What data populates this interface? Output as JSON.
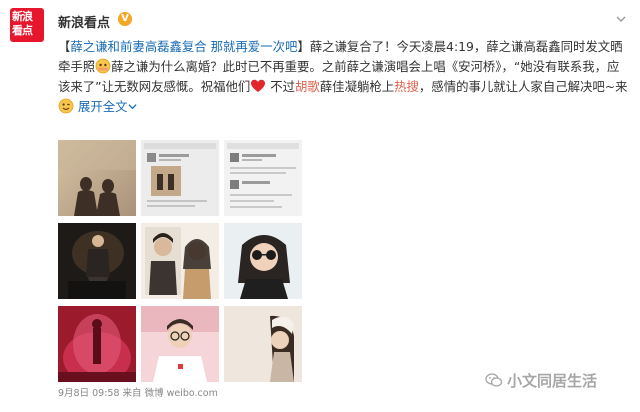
{
  "account": {
    "avatar_line1": "新浪",
    "avatar_line2": "看点",
    "name": "新浪看点",
    "verified_icon": "verified-v-badge"
  },
  "post": {
    "p1": "【",
    "title": "薛之谦和前妻高磊鑫复合 那就再爱一次吧",
    "p2": "】薛之谦复合了！今天凌晨4:19，薛之谦高磊鑫同时发文晒牵手照",
    "p3": "薛之谦为什么离婚？此时已不再重要。之前薛之谦演唱会上唱《安河桥》，“她没有联系我，应该来了”让无数网友感慨。祝福他们",
    "p4": " 不过",
    "highlight1": "胡歌",
    "p5": "薛佳凝躺枪上",
    "highlight2": "热搜",
    "p6": "，感情的事儿就让人家自己解决吧~来",
    "expand_label": "展开全文",
    "link_color": "#1a6bb5",
    "highlight_color": "#e0604d"
  },
  "images": [
    "shadow-silhouette-photo",
    "chat-screenshot-photo",
    "chat-screenshot-photo",
    "stage-performer-photo",
    "magazine-portrait-photo",
    "sunglasses-portrait-photo",
    "pink-stage-photo",
    "man-with-glasses-photo",
    "woman-profile-photo"
  ],
  "footer": {
    "time": "9月8日 09:58",
    "source_prefix": "来自",
    "source": "微博 weibo.com"
  },
  "watermark": {
    "icon": "wechat-icon",
    "text": "小文同居生活"
  }
}
